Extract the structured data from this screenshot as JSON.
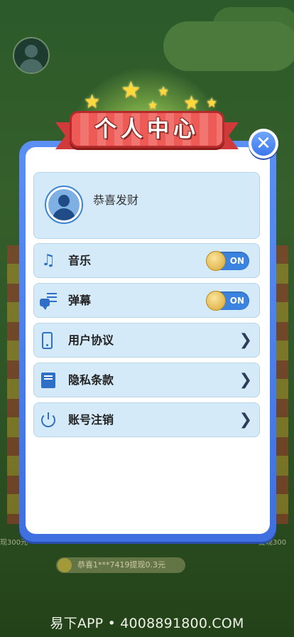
{
  "title": "个人中心",
  "profile": {
    "username": "恭喜发财"
  },
  "settings": [
    {
      "id": "music",
      "label": "音乐",
      "icon": "music-note-icon",
      "type": "toggle",
      "toggle_text": "ON"
    },
    {
      "id": "danmaku",
      "label": "弹幕",
      "icon": "bullet-comment-icon",
      "type": "toggle",
      "toggle_text": "ON"
    },
    {
      "id": "agreement",
      "label": "用户协议",
      "icon": "phone-icon",
      "type": "link"
    },
    {
      "id": "privacy",
      "label": "隐私条款",
      "icon": "document-icon",
      "type": "link"
    },
    {
      "id": "deactivate",
      "label": "账号注销",
      "icon": "power-icon",
      "type": "link"
    }
  ],
  "background": {
    "ticker": "恭喜1***7419提现0.3元",
    "left_edge_text": "现300元",
    "right_edge_text": "提现300"
  },
  "watermark": "易下APP • 4008891800.COM",
  "colors": {
    "modal_border": "#4a7fe8",
    "row_bg": "#d4eaf8",
    "banner_red": "#ee5a55",
    "toggle_blue": "#3a83e0"
  }
}
